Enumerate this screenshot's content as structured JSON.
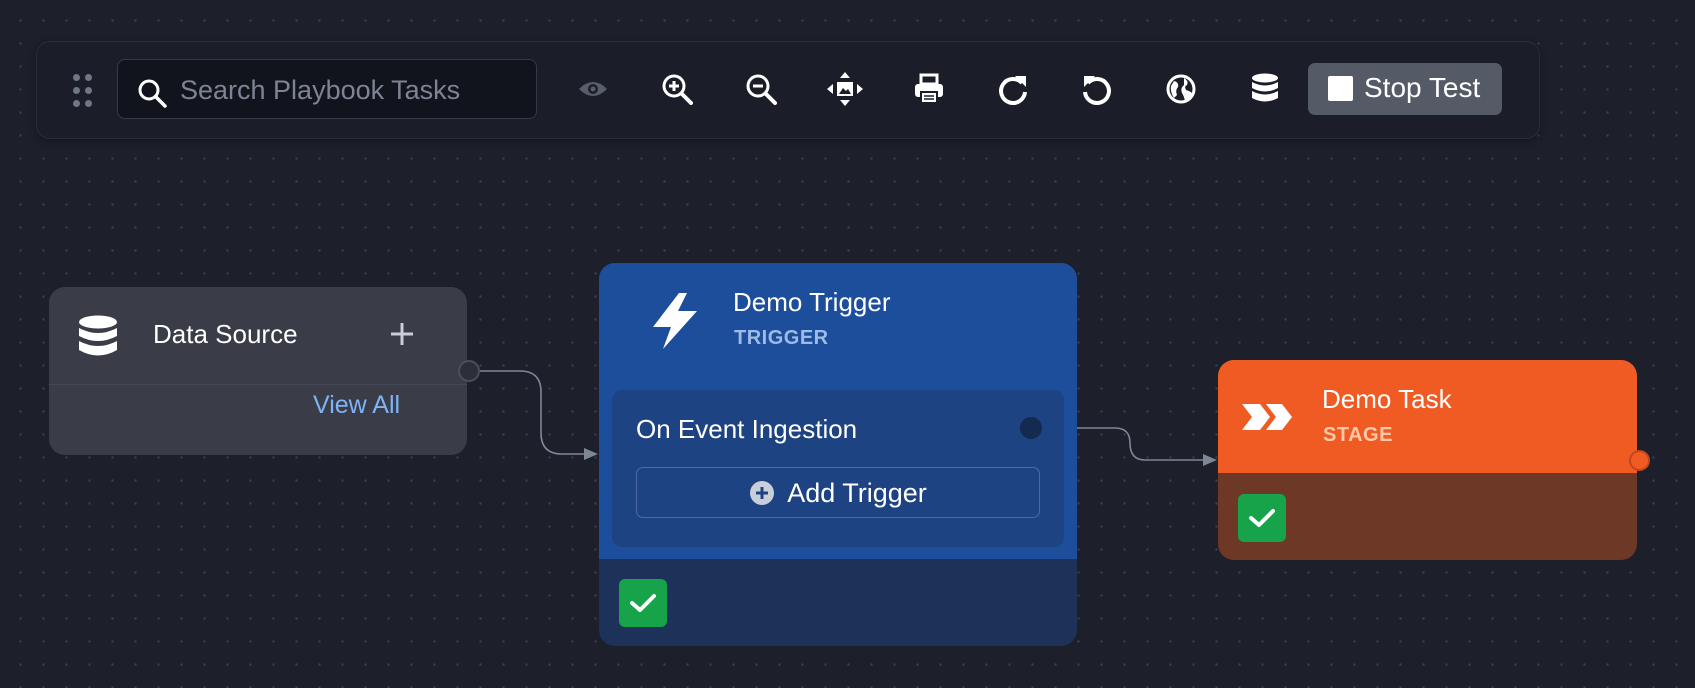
{
  "toolbar": {
    "search_placeholder": "Search Playbook Tasks",
    "tools": [
      "eye-icon",
      "zoom-in-icon",
      "zoom-out-icon",
      "fit-view-icon",
      "print-icon",
      "redo-icon",
      "undo-icon",
      "globe-icon",
      "database-icon"
    ],
    "stop_test_label": "Stop Test"
  },
  "nodes": {
    "data_source": {
      "title": "Data Source",
      "view_all_label": "View All",
      "icon": "database-icon"
    },
    "trigger": {
      "title": "Demo Trigger",
      "subtitle": "TRIGGER",
      "event_label": "On Event Ingestion",
      "add_trigger_label": "Add Trigger",
      "icon": "lightning-icon",
      "status": "check-icon"
    },
    "task": {
      "title": "Demo Task",
      "subtitle": "STAGE",
      "icon": "stage-chevrons-icon",
      "status": "check-icon"
    }
  },
  "colors": {
    "canvas_bg": "#1d202b",
    "trigger_header": "#1d4e9b",
    "task_header": "#f05b23",
    "success": "#16a34a",
    "link": "#7fb3f5"
  }
}
